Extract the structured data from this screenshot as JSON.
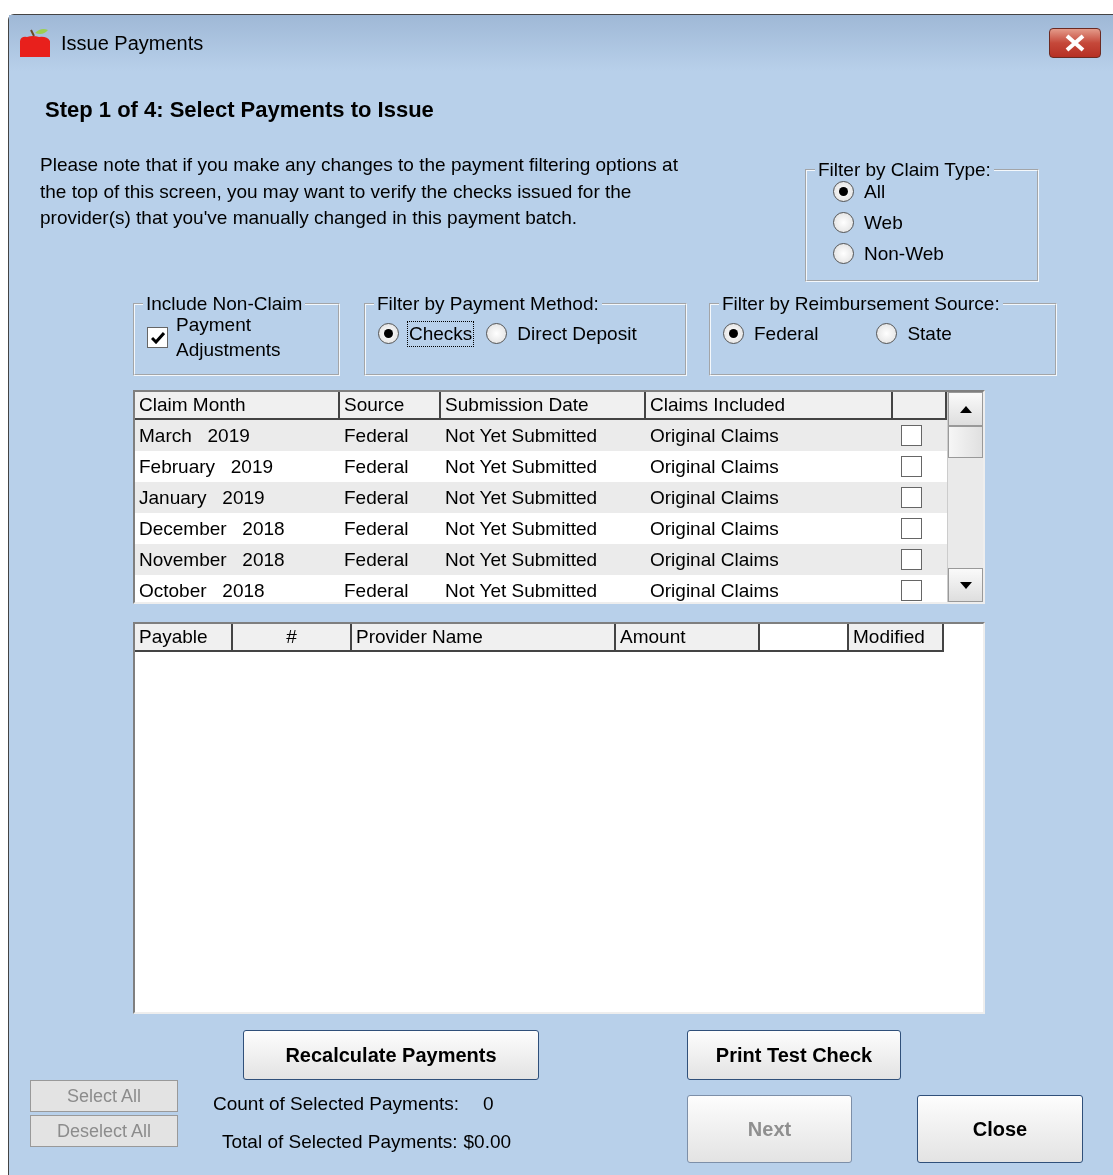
{
  "window": {
    "title": "Issue Payments"
  },
  "heading": "Step 1 of 4: Select Payments to Issue",
  "note": "Please note that if you make any changes to the payment filtering options at the top of this screen, you may want to verify the checks issued for the provider(s) that you've manually changed in this payment batch.",
  "claim_type": {
    "label": "Filter by Claim Type:",
    "options": [
      {
        "label": "All",
        "selected": true
      },
      {
        "label": "Web",
        "selected": false
      },
      {
        "label": "Non-Web",
        "selected": false
      }
    ]
  },
  "non_claim": {
    "label": "Include Non-Claim",
    "checkbox_label": "Payment Adjustments",
    "checked": true
  },
  "payment_method": {
    "label": "Filter by Payment Method:",
    "options": [
      {
        "label": "Checks",
        "selected": true,
        "focused": true
      },
      {
        "label": "Direct Deposit",
        "selected": false,
        "focused": false
      }
    ]
  },
  "reimbursement_source": {
    "label": "Filter by Reimbursement Source:",
    "options": [
      {
        "label": "Federal",
        "selected": true
      },
      {
        "label": "State",
        "selected": false
      }
    ]
  },
  "claims_table": {
    "columns": [
      "Claim Month",
      "Source",
      "Submission Date",
      "Claims Included"
    ],
    "rows": [
      {
        "claim_month": "March 2019",
        "source": "Federal",
        "submission_date": "Not Yet Submitted",
        "claims_included": "Original Claims",
        "checked": false
      },
      {
        "claim_month": "February 2019",
        "source": "Federal",
        "submission_date": "Not Yet Submitted",
        "claims_included": "Original Claims",
        "checked": false
      },
      {
        "claim_month": "January 2019",
        "source": "Federal",
        "submission_date": "Not Yet Submitted",
        "claims_included": "Original Claims",
        "checked": false
      },
      {
        "claim_month": "December 2018",
        "source": "Federal",
        "submission_date": "Not Yet Submitted",
        "claims_included": "Original Claims",
        "checked": false
      },
      {
        "claim_month": "November 2018",
        "source": "Federal",
        "submission_date": "Not Yet Submitted",
        "claims_included": "Original Claims",
        "checked": false
      },
      {
        "claim_month": "October 2018",
        "source": "Federal",
        "submission_date": "Not Yet Submitted",
        "claims_included": "Original Claims",
        "checked": false
      }
    ]
  },
  "payments_table": {
    "columns": [
      {
        "kind": "text",
        "label": "Payable"
      },
      {
        "kind": "text",
        "label": "#"
      },
      {
        "kind": "text",
        "label": "Provider Name"
      },
      {
        "kind": "text",
        "label": "Amount"
      },
      {
        "kind": "blank"
      },
      {
        "kind": "text",
        "label": "Modified"
      }
    ]
  },
  "buttons": {
    "recalculate": {
      "label": "Recalculate Payments",
      "disabled": false
    },
    "print_test_check": {
      "label": "Print Test Check",
      "disabled": false
    },
    "select_all": {
      "label": "Select All",
      "disabled": true
    },
    "deselect_all": {
      "label": "Deselect All",
      "disabled": true
    },
    "next": {
      "label": "Next",
      "disabled": true
    },
    "close": {
      "label": "Close",
      "disabled": false
    }
  },
  "summary": {
    "count_label": "Count of Selected Payments:",
    "count": "0",
    "total_label": "Total of Selected Payments:",
    "total": "$0.00"
  }
}
